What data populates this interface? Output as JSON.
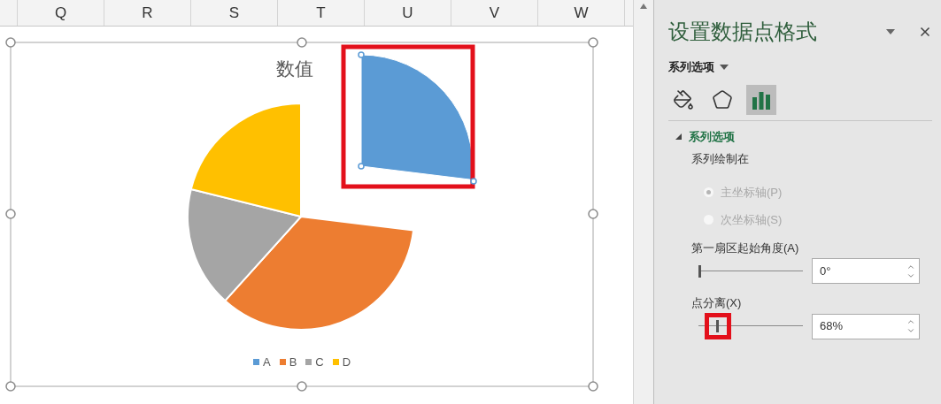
{
  "columns": [
    "Q",
    "R",
    "S",
    "T",
    "U",
    "V",
    "W"
  ],
  "chart": {
    "title": "数值",
    "legend": [
      {
        "label": "A",
        "color": "#5b9bd5"
      },
      {
        "label": "B",
        "color": "#ed7d31"
      },
      {
        "label": "C",
        "color": "#a5a5a5"
      },
      {
        "label": "D",
        "color": "#ffc000"
      }
    ]
  },
  "panel": {
    "title": "设置数据点格式",
    "options_menu": "系列选项",
    "tabs": [
      {
        "kind": "fill",
        "selected": false
      },
      {
        "kind": "effects",
        "selected": false
      },
      {
        "kind": "options",
        "selected": true
      }
    ],
    "section": {
      "title": "系列选项",
      "expanded": true,
      "plot_on_label": "系列绘制在",
      "radios": [
        {
          "label": "主坐标轴(P)",
          "selected": true,
          "disabled": true
        },
        {
          "label": "次坐标轴(S)",
          "selected": false,
          "disabled": true
        }
      ],
      "fields": [
        {
          "label": "第一扇区起始角度(A)",
          "level": 0,
          "value": "0°",
          "highlighted": false
        },
        {
          "label": "点分离(X)",
          "level": 0.17,
          "value": "68%",
          "highlighted": true
        }
      ]
    }
  }
}
